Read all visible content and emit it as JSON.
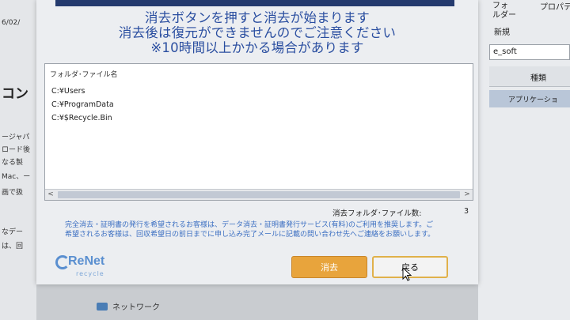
{
  "background": {
    "left_texts": [
      "6/02/",
      "コン",
      "ージャパ",
      "ロード後",
      "なる製",
      "Mac、ー",
      "画で扱",
      "なデー",
      "は、回"
    ],
    "right_texts": {
      "top_left": "フォ\nルダー",
      "top_right": "プロパティ",
      "new": "新規",
      "soft_bar": "e_soft",
      "type_header": "種類",
      "app_row": "アプリケーショ"
    },
    "network_label": "ネットワーク"
  },
  "dialog": {
    "warning_lines": [
      "消去ボタンを押すと消去が始まります",
      "消去後は復元ができませんのでご注意ください",
      "※10時間以上かかる場合があります"
    ],
    "list": {
      "header": "フォルダ･ファイル名",
      "items": [
        "C:¥Users",
        "C:¥ProgramData",
        "C:¥$Recycle.Bin"
      ]
    },
    "count": {
      "label": "消去フォルダ･ファイル数:",
      "value": "3"
    },
    "notice": "完全消去・証明書の発行を希望されるお客様は、データ消去・証明書発行サービス(有料)のご利用を推奨します。ご希望されるお客様は、回収希望日の前日までに申し込み完了メールに記載の問い合わせ先へご連絡をお願いします。",
    "logo": {
      "name": "ReNet",
      "sub": "recycle"
    },
    "buttons": {
      "delete": "消去",
      "back": "戻る"
    }
  },
  "colors": {
    "warning_text": "#2a4ea0",
    "notice_text": "#3b6fc2",
    "delete_button": "#e8a43c",
    "back_border": "#e0b14a"
  }
}
